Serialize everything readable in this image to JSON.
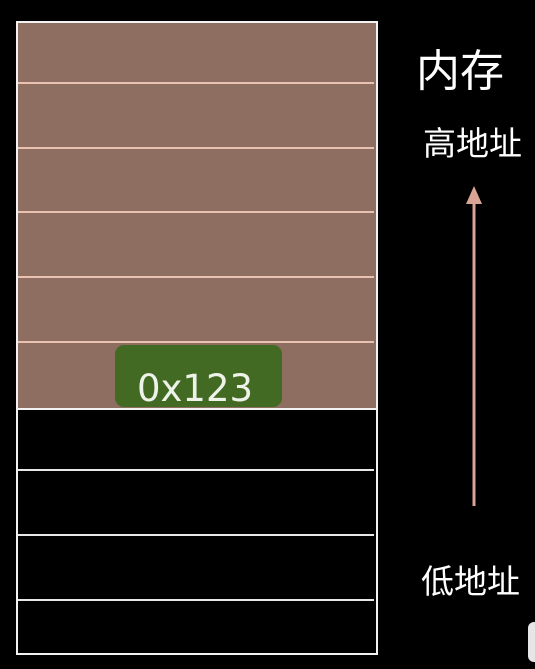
{
  "title": "内存",
  "high_address_label": "高地址",
  "low_address_label": "低地址",
  "highlighted_cell_value": "0x123",
  "colors": {
    "used_region": "#8f6e62",
    "highlight_cell": "#436a22",
    "arrow": "#d9a493",
    "background": "#000000"
  }
}
